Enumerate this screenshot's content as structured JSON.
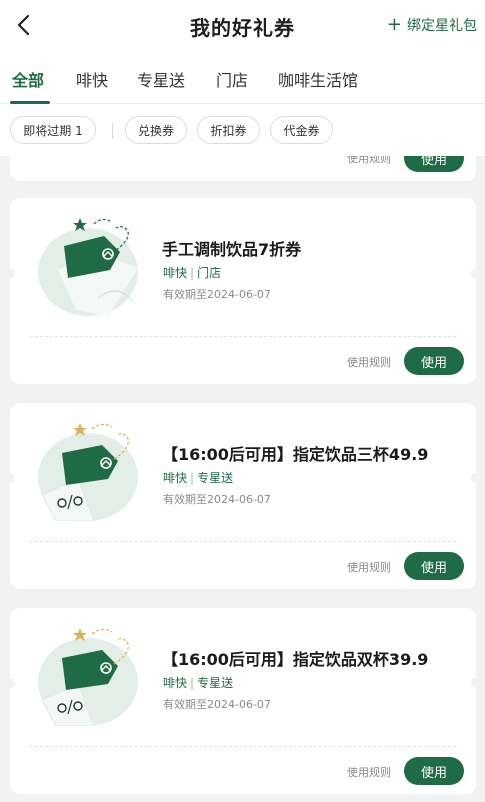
{
  "header": {
    "title": "我的好礼券",
    "bind_label": "绑定星礼包",
    "plus_symbol": "+"
  },
  "tabs": [
    {
      "label": "全部",
      "active": true
    },
    {
      "label": "啡快",
      "active": false
    },
    {
      "label": "专星送",
      "active": false
    },
    {
      "label": "门店",
      "active": false
    },
    {
      "label": "咖啡生活馆",
      "active": false
    }
  ],
  "filters": {
    "expiring": "即将过期 1",
    "chips": [
      "兑换券",
      "折扣券",
      "代金券"
    ]
  },
  "coupons": [
    {
      "title": "",
      "channels": [],
      "validity": "",
      "rules_label": "使用规则",
      "use_label": "使用"
    },
    {
      "title": "手工调制饮品7折券",
      "channels": [
        "啡快",
        "门店"
      ],
      "validity": "有效期至2024-06-07",
      "rules_label": "使用规则",
      "use_label": "使用",
      "star_color": "#1f6b45"
    },
    {
      "title": "【16:00后可用】指定饮品三杯49.9",
      "channels": [
        "啡快",
        "专星送"
      ],
      "validity": "有效期至2024-06-07",
      "rules_label": "使用规则",
      "use_label": "使用",
      "star_color": "#d9b35a"
    },
    {
      "title": "【16:00后可用】指定饮品双杯39.9",
      "channels": [
        "啡快",
        "专星送"
      ],
      "validity": "有效期至2024-06-07",
      "rules_label": "使用规则",
      "use_label": "使用",
      "star_color": "#d9b35a"
    }
  ],
  "colors": {
    "brand_green": "#1f6b45",
    "background": "#f2f2f2"
  },
  "icons": {
    "back": "chevron-left-icon",
    "coupon_tag": "price-tag-icon",
    "star": "star-icon"
  }
}
